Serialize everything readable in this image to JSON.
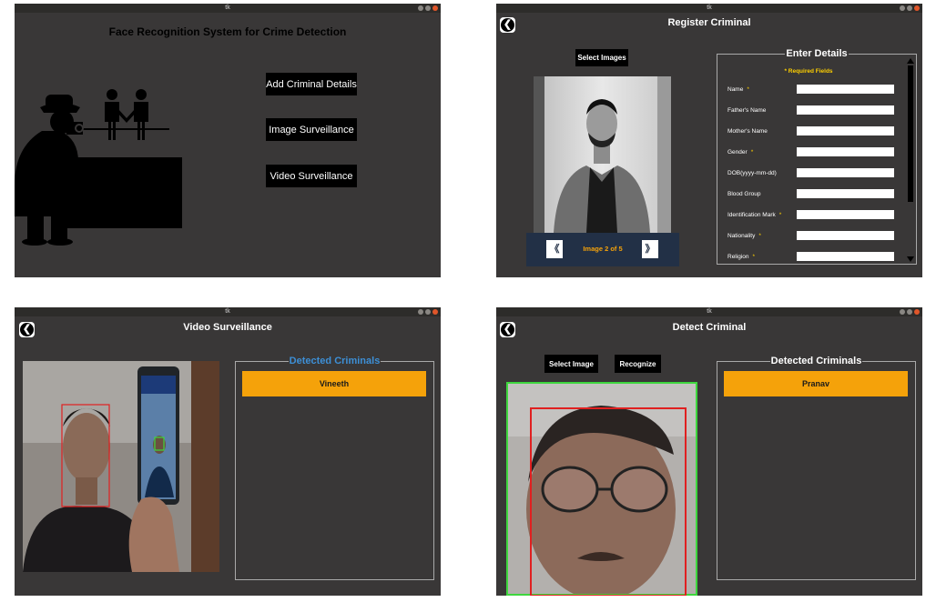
{
  "home": {
    "window_title": "tk",
    "heading": "Face Recognition System for Crime Detection",
    "buttons": [
      "Add Criminal Details",
      "Image Surveillance",
      "Video Surveillance"
    ]
  },
  "register": {
    "window_title": "tk",
    "heading": "Register Criminal",
    "back_glyph": "❮",
    "select_images": "Select Images",
    "image_counter": "Image 2 of 5",
    "prev_glyph": "《",
    "next_glyph": "》",
    "details_legend": "Enter Details",
    "required_note": "* Required Fields",
    "fields": [
      {
        "label": "Name",
        "required": "*"
      },
      {
        "label": "Father's Name",
        "required": ""
      },
      {
        "label": "Mother's Name",
        "required": ""
      },
      {
        "label": "Gender",
        "required": "*"
      },
      {
        "label": "DOB(yyyy-mm-dd)",
        "required": ""
      },
      {
        "label": "Blood Group",
        "required": ""
      },
      {
        "label": "Identification Mark",
        "required": "*"
      },
      {
        "label": "Nationality",
        "required": "*"
      },
      {
        "label": "Religion",
        "required": "*"
      }
    ]
  },
  "video": {
    "window_title": "tk",
    "heading": "Video Surveillance",
    "back_glyph": "❮",
    "panel_legend": "Detected Criminals",
    "detected": [
      "Vineeth"
    ]
  },
  "detect": {
    "window_title": "tk",
    "heading": "Detect Criminal",
    "back_glyph": "❮",
    "select_image": "Select Image",
    "recognize": "Recognize",
    "panel_legend": "Detected Criminals",
    "detected": [
      "Pranav"
    ]
  },
  "colors": {
    "window_bg": "#393737",
    "accent_orange": "#f5a20a",
    "legend_blue": "#3d8fd6",
    "required_yellow": "#ffd000",
    "face_box_red": "#e02020",
    "face_box_green": "#3ed63e"
  }
}
